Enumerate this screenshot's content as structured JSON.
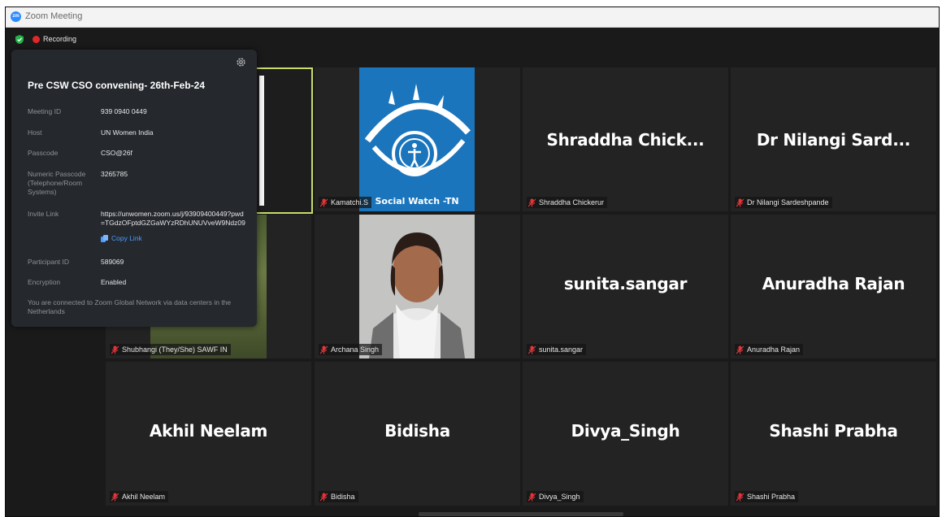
{
  "window": {
    "title": "Zoom Meeting",
    "app_icon_text": "zm"
  },
  "status": {
    "recording_label": "Recording"
  },
  "meeting_info": {
    "title": "Pre CSW CSO convening- 26th-Feb-24",
    "meeting_id_label": "Meeting ID",
    "meeting_id": "939 0940 0449",
    "host_label": "Host",
    "host": "UN Women India",
    "passcode_label": "Passcode",
    "passcode": "CSO@26f",
    "numeric_passcode_label_1": "Numeric Passcode",
    "numeric_passcode_label_2": "(Telephone/Room",
    "numeric_passcode_label_3": "Systems)",
    "numeric_passcode": "3265785",
    "invite_link_label": "Invite Link",
    "invite_link_line1": "https://unwomen.zoom.us/j/93909400449?pwd",
    "invite_link_line2": "=TGdzOFptdGZGaWYzRDhUNUVveW9Ndz09",
    "copy_link_label": "Copy Link",
    "participant_id_label": "Participant ID",
    "participant_id": "589069",
    "encryption_label": "Encryption",
    "encryption": "Enabled",
    "note_line1": "You are connected to Zoom Global Network via data centers in the",
    "note_line2": "Netherlands"
  },
  "participants": [
    {
      "label": "Shubhangi (They/She) SAWF IN"
    },
    {
      "label": "Kamatchi.S",
      "logo_text": "Social Watch -TN"
    },
    {
      "name": "Shraddha Chick...",
      "label": "Shraddha Chickerur"
    },
    {
      "name": "Dr Nilangi Sard...",
      "label": "Dr Nilangi Sardeshpande"
    },
    {
      "label": "Archana Singh"
    },
    {
      "name": "sunita.sangar",
      "label": "sunita.sangar"
    },
    {
      "name": "Anuradha Rajan",
      "label": "Anuradha Rajan"
    },
    {
      "name": "Akhil Neelam",
      "label": "Akhil Neelam"
    },
    {
      "name": "Bidisha",
      "label": "Bidisha"
    },
    {
      "name": "Divya_Singh",
      "label": "Divya_Singh"
    },
    {
      "name": "Shashi Prabha",
      "label": "Shashi Prabha"
    }
  ],
  "colors": {
    "active_speaker": "#c6dd6a",
    "muted": "#e0353a",
    "accent": "#2d8cff"
  }
}
